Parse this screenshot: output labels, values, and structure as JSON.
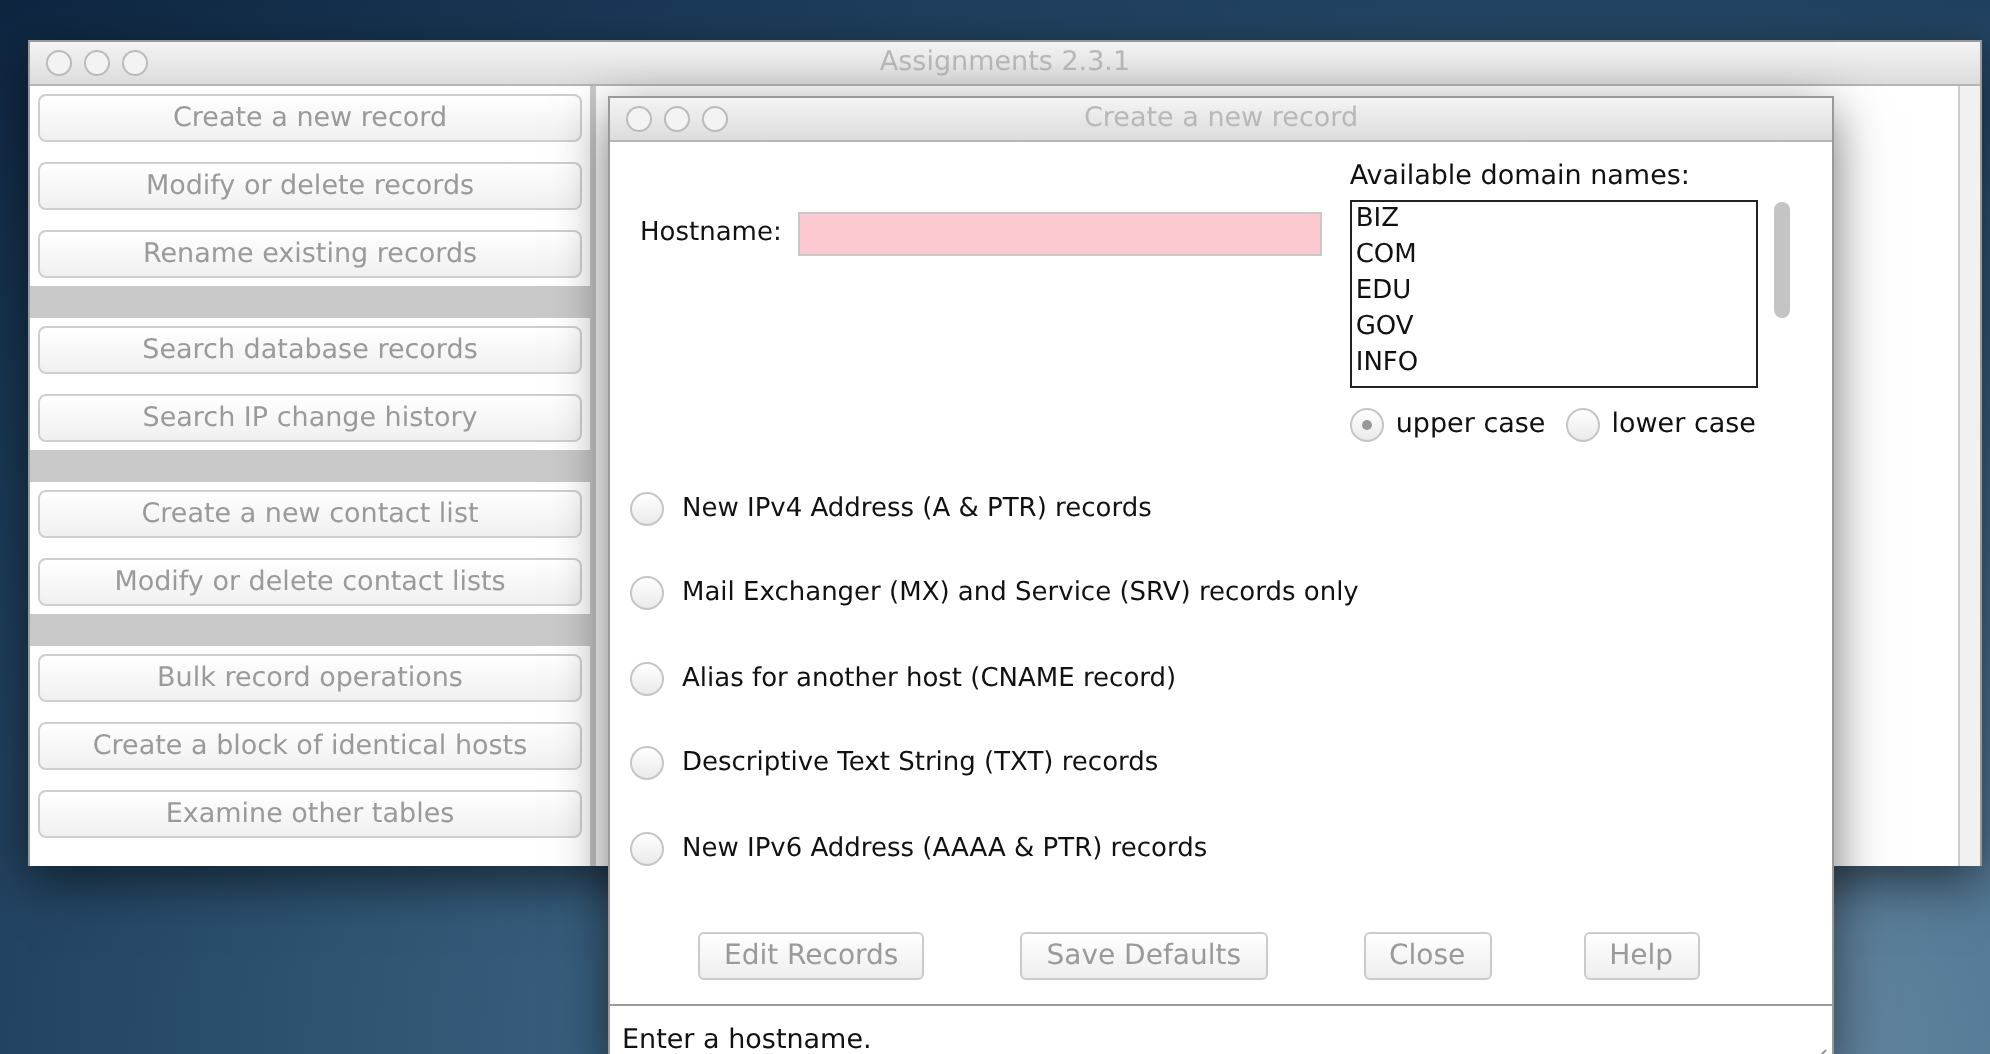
{
  "main_window": {
    "title": "Assignments 2.3.1",
    "menu_groups": [
      [
        {
          "label": "Create a new record",
          "disabled": true
        },
        {
          "label": "Modify or delete records",
          "disabled": true
        },
        {
          "label": "Rename existing records",
          "disabled": true
        }
      ],
      [
        {
          "label": "Search database records",
          "disabled": true
        },
        {
          "label": "Search IP change history",
          "disabled": true
        }
      ],
      [
        {
          "label": "Create a new contact list",
          "disabled": true
        },
        {
          "label": "Modify or delete contact lists",
          "disabled": true
        }
      ],
      [
        {
          "label": "Bulk record operations",
          "disabled": true
        },
        {
          "label": "Create a block of identical hosts",
          "disabled": true
        },
        {
          "label": "Examine other tables",
          "disabled": true
        }
      ]
    ]
  },
  "dialog": {
    "title": "Create a new record",
    "hostname": {
      "label": "Hostname:",
      "invalid": true
    },
    "domains": {
      "label": "Available domain names:",
      "items": [
        "BIZ",
        "COM",
        "EDU",
        "GOV",
        "INFO"
      ]
    },
    "case_options": [
      {
        "label": "upper case",
        "selected": true
      },
      {
        "label": "lower case",
        "selected": false
      }
    ],
    "record_types": [
      {
        "label": "New IPv4 Address (A & PTR) records",
        "selected": false
      },
      {
        "label": "Mail Exchanger (MX) and Service (SRV) records only",
        "selected": false
      },
      {
        "label": "Alias for another host (CNAME record)",
        "selected": false
      },
      {
        "label": "Descriptive Text String (TXT) records",
        "selected": false
      },
      {
        "label": "New IPv6 Address (AAAA & PTR) records",
        "selected": false
      }
    ],
    "buttons": [
      {
        "label": "Edit Records",
        "disabled": true
      },
      {
        "label": "Save Defaults",
        "disabled": true
      },
      {
        "label": "Close",
        "disabled": true
      },
      {
        "label": "Help",
        "disabled": true
      }
    ],
    "status": "Enter a hostname."
  }
}
